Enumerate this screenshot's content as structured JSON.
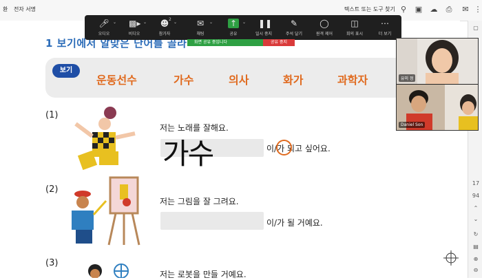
{
  "topbar": {
    "menu_left": "환",
    "menu_signature": "전자 서명",
    "search_placeholder": "텍스트 또는 도구 찾기"
  },
  "toolbar": {
    "buttons": [
      {
        "label": "오디오",
        "icon": "microphone-icon"
      },
      {
        "label": "비디오",
        "icon": "video-camera-icon"
      },
      {
        "label": "참가자",
        "icon": "participants-icon",
        "count": "2"
      },
      {
        "label": "채팅",
        "icon": "chat-icon"
      },
      {
        "label": "공유",
        "icon": "share-screen-icon"
      },
      {
        "label": "일시 중지",
        "icon": "pause-icon"
      },
      {
        "label": "주석 달기",
        "icon": "annotate-pencil-icon"
      },
      {
        "label": "원격 제어",
        "icon": "remote-control-mouse-icon"
      },
      {
        "label": "회의 표시",
        "icon": "meeting-display-icon"
      },
      {
        "label": "더 보기",
        "icon": "more-icon"
      }
    ],
    "sharing_notice": "화면 공유 중입니다",
    "stop_share": "공유 중지"
  },
  "document": {
    "heading": "1 보기에서 알맞은 단어를 골라",
    "bogi_label": "보기",
    "words": [
      "운동선수",
      "가수",
      "의사",
      "화가",
      "과학자"
    ],
    "questions": [
      {
        "num": "(1)",
        "sentence": "저는 노래를 잘해요.",
        "handwritten_answer": "가수",
        "suffix": "이/가 되고 싶어요."
      },
      {
        "num": "(2)",
        "sentence": "저는 그림을 잘 그려요.",
        "suffix": "이/가 될 거예요."
      },
      {
        "num": "(3)",
        "sentence": "저는 로봇을 만들 거예요."
      }
    ]
  },
  "right_strip": {
    "page_current": "17",
    "page_total": "94"
  },
  "video": {
    "tiles": [
      {
        "name": "유미 정"
      },
      {
        "name": "Daniel Son"
      }
    ]
  },
  "colors": {
    "heading_blue": "#2a6bb8",
    "word_orange": "#e06a1e",
    "badge_navy": "#1f4ea6",
    "share_green": "#2ea043",
    "stop_red": "#d93a3a"
  }
}
